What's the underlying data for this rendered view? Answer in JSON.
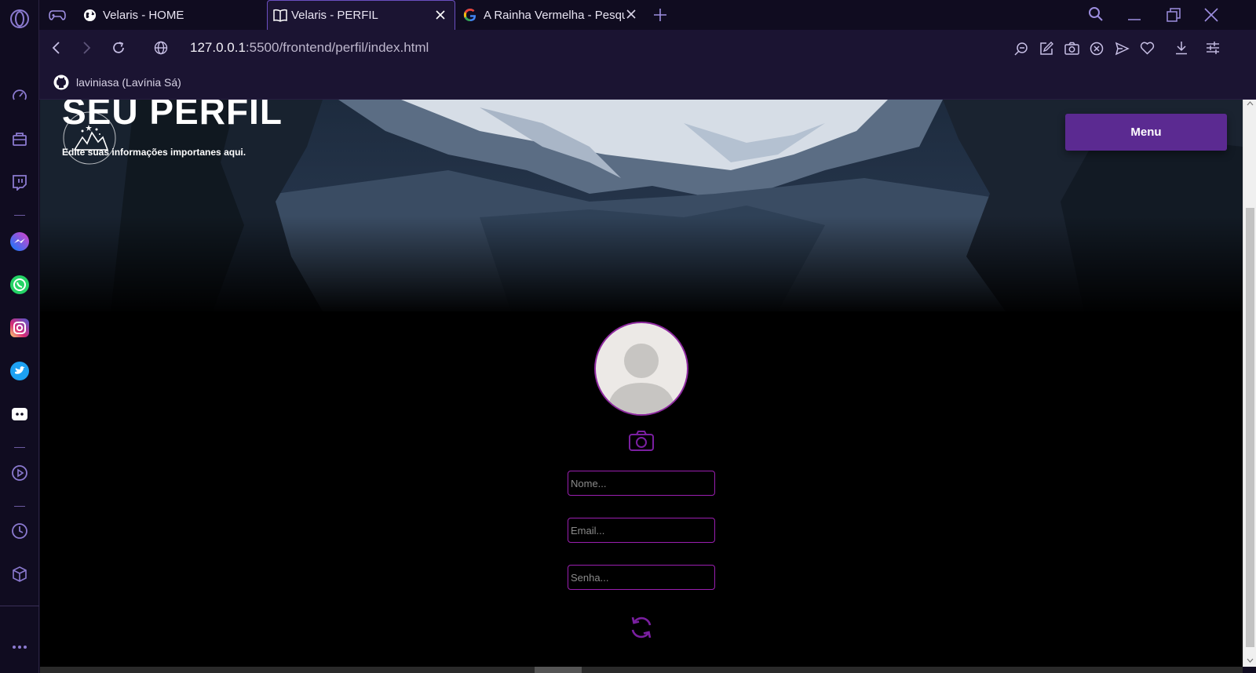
{
  "browser": {
    "tabs": [
      {
        "label": "Velaris - HOME",
        "active": false
      },
      {
        "label": "Velaris - PERFIL",
        "active": true
      },
      {
        "label": "A Rainha Vermelha - Pesqu",
        "active": false
      }
    ],
    "url_host": "127.0.0.1",
    "url_rest": ":5500/frontend/perfil/index.html",
    "bookmark_label": "laviniasa (Lavínia Sá)",
    "sidebar_icons": [
      "opera-logo-icon",
      "speed-dial-icon",
      "bag-icon",
      "twitch-icon",
      "messenger-icon",
      "whatsapp-icon",
      "instagram-icon",
      "twitter-icon",
      "discord-icon",
      "player-icon",
      "history-icon",
      "cube-icon",
      "more-icon"
    ],
    "accent": "#6b4fc0"
  },
  "page": {
    "title": "SEU PERFIL",
    "subtitle": "Edite suas informações importanes aqui.",
    "menu_label": "Menu",
    "fields": {
      "name_placeholder": "Nome...",
      "email_placeholder": "Email...",
      "password_placeholder": "Senha..."
    },
    "colors": {
      "menu_button": "#5b2a91",
      "field_border": "#9a1fb0",
      "icon_purple": "#7a1fa0"
    }
  }
}
